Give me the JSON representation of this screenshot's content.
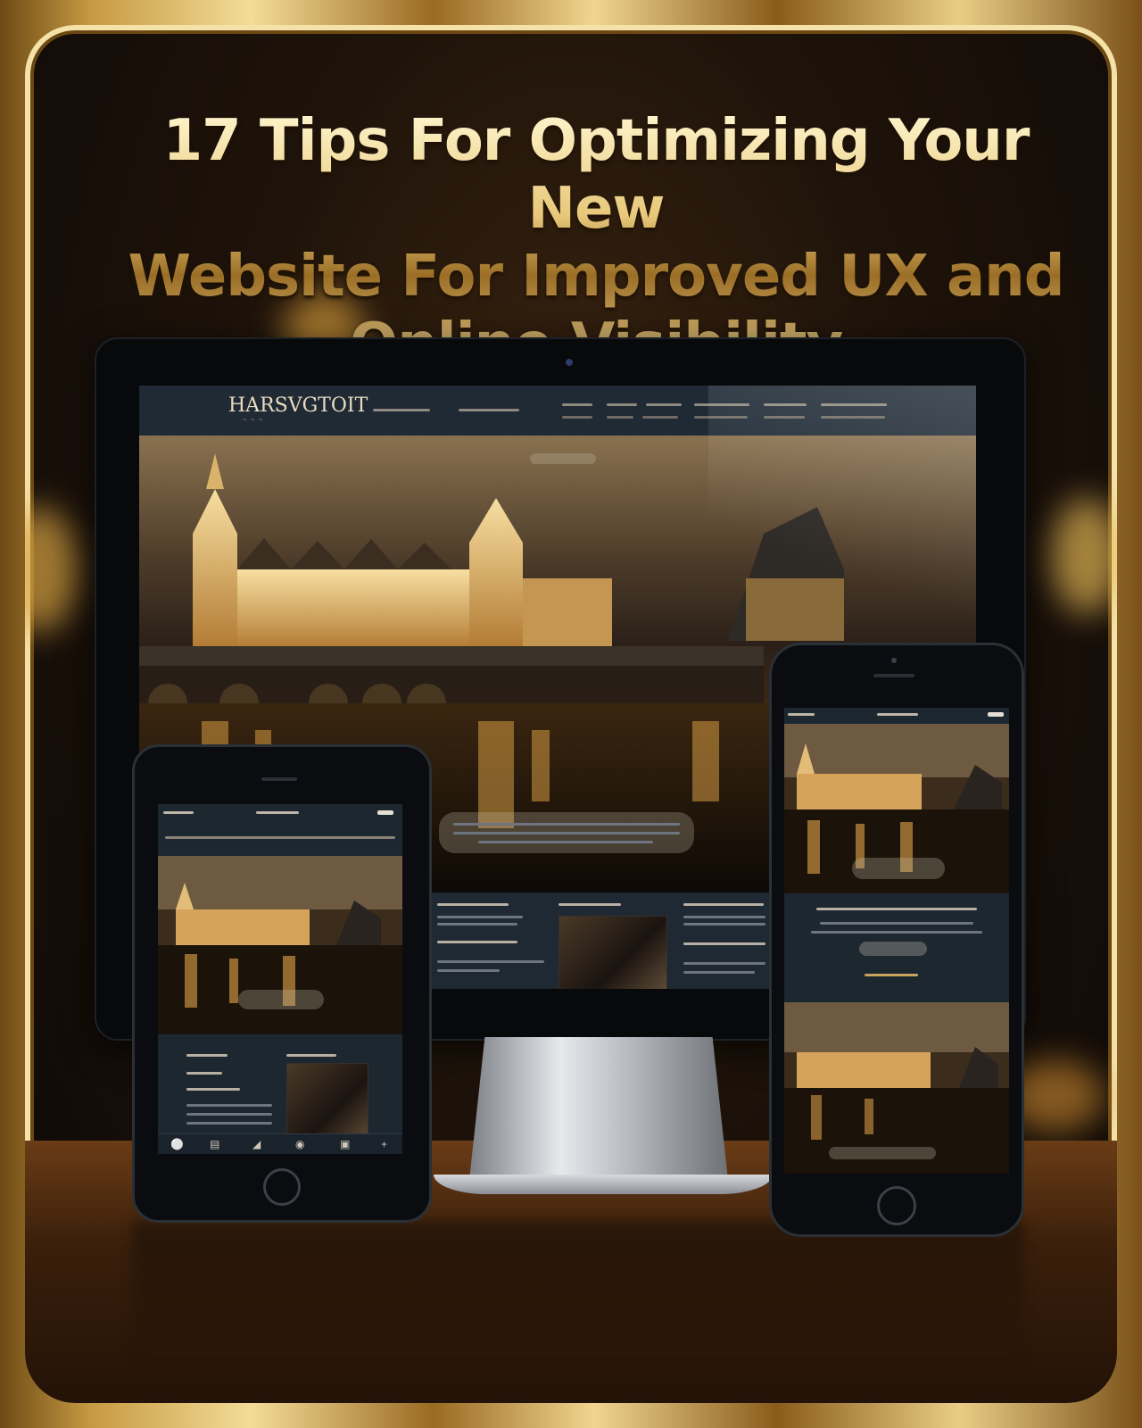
{
  "title": {
    "line1": "17 Tips For Optimizing Your New",
    "line2": "Website For Improved UX and",
    "line3": "Online Visibility"
  },
  "colors": {
    "gold": "#e6c77a",
    "screen_bg": "#1c2630",
    "card_bg": "#1e130a"
  },
  "devices": [
    "desktop-monitor",
    "tablet",
    "smartphone"
  ],
  "tablet_icons": [
    "user-icon",
    "document-icon",
    "pen-icon",
    "globe-icon",
    "bookmark-icon",
    "plus-icon"
  ]
}
